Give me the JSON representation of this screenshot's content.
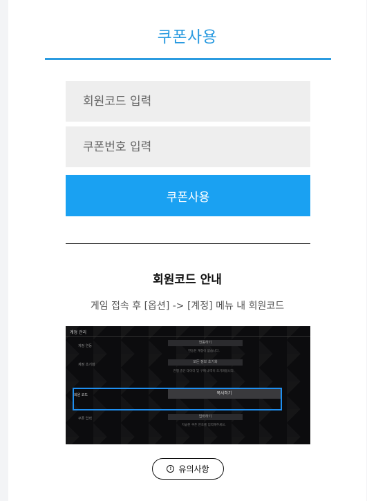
{
  "header": {
    "title": "쿠폰사용"
  },
  "form": {
    "member_code_placeholder": "회원코드 입력",
    "coupon_number_placeholder": "쿠폰번호 입력",
    "submit_label": "쿠폰사용"
  },
  "guide": {
    "title": "회원코드 안내",
    "description": "게임 접속 후 [옵션] -> [계정] 메뉴 내 회원코드",
    "screenshot": {
      "header": "계정 관리",
      "rows": [
        {
          "label": "계정 연동",
          "button": "연동하기",
          "note": "연동된 계정이 없습니다."
        },
        {
          "label": "계정 초기화",
          "button": "모든 정보 초기화",
          "note": "진행 중인 데이터 및 구매 내역이 초기화됩니다."
        },
        {
          "label": "회원 코드",
          "button": "복사하기",
          "note": ""
        },
        {
          "label": "쿠폰 입력",
          "button": "입력하기",
          "note": "지급된 쿠폰 번호를 입력해주세요."
        }
      ]
    }
  },
  "caution": {
    "icon": "info-circle-icon",
    "label": "유의사항"
  },
  "colors": {
    "accent": "#2b9be0",
    "button": "#1aa1f2",
    "highlight": "#1f8ff0"
  }
}
